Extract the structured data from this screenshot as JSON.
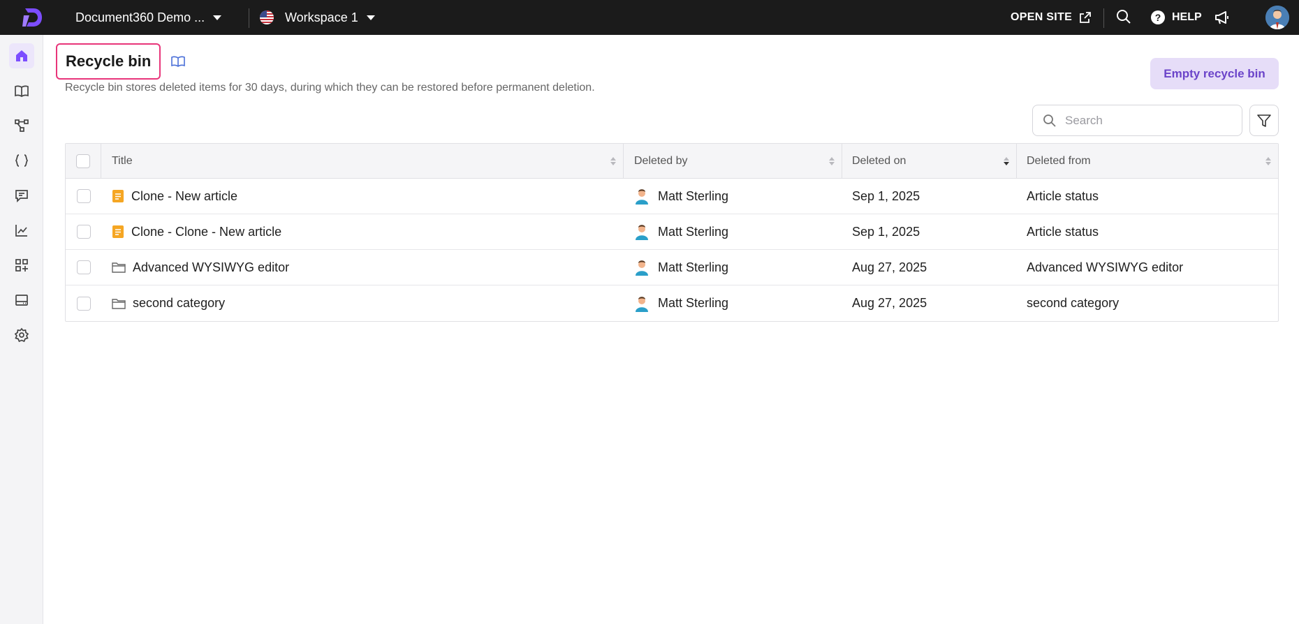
{
  "topbar": {
    "project_name": "Document360 Demo ...",
    "workspace_name": "Workspace 1",
    "open_site_label": "OPEN SITE",
    "help_label": "HELP"
  },
  "page": {
    "title": "Recycle bin",
    "subtitle": "Recycle bin stores deleted items for 30 days, during which they can be restored before permanent deletion.",
    "empty_button_label": "Empty recycle bin",
    "search_placeholder": "Search"
  },
  "table": {
    "columns": [
      "Title",
      "Deleted by",
      "Deleted on",
      "Deleted from"
    ],
    "rows": [
      {
        "title": "Clone - New article",
        "type": "article-icon",
        "deleted_by": "Matt Sterling",
        "deleted_on": "Sep 1, 2025",
        "deleted_from": "Article status"
      },
      {
        "title": "Clone - Clone - New article",
        "type": "article-icon",
        "deleted_by": "Matt Sterling",
        "deleted_on": "Sep 1, 2025",
        "deleted_from": "Article status"
      },
      {
        "title": "Advanced WYSIWYG editor",
        "type": "folder-icon",
        "deleted_by": "Matt Sterling",
        "deleted_on": "Aug 27, 2025",
        "deleted_from": "Advanced WYSIWYG editor"
      },
      {
        "title": "second category",
        "type": "folder-icon",
        "deleted_by": "Matt Sterling",
        "deleted_on": "Aug 27, 2025",
        "deleted_from": "second category"
      }
    ]
  },
  "sidebar": {
    "items": [
      "home-icon",
      "book-icon",
      "hierarchy-icon",
      "code-braces-icon",
      "comment-icon",
      "analytics-icon",
      "apps-icon",
      "widget-icon",
      "settings-icon"
    ]
  },
  "colors": {
    "topbar_bg": "#1b1b1b",
    "accent": "#6b44c9",
    "accent_light": "#e6ddf8",
    "highlight_border": "#e8357a",
    "article_icon": "#f5a623"
  }
}
